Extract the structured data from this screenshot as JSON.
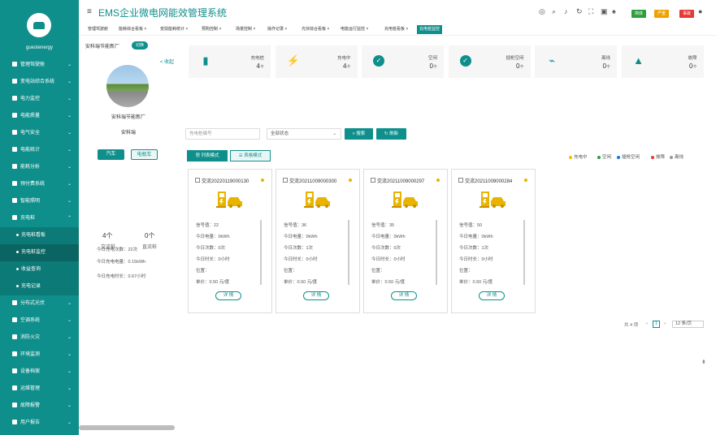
{
  "app": {
    "title": "EMS企业微电网能效管理系统",
    "user": "guestenergy"
  },
  "topbar": {
    "badges": [
      {
        "label": "简体",
        "color": "#2e9e3e"
      },
      {
        "label": "严重",
        "color": "#f0a000"
      },
      {
        "label": "事故",
        "color": "#e53935"
      }
    ]
  },
  "tabs": [
    "管理驾驶舱",
    "能耗综合看板",
    "变损能耗统计",
    "预购控制",
    "场景控制",
    "操作记录",
    "光伏综合看板",
    "电能运行监控",
    "充电桩看板",
    "充电桩监控"
  ],
  "sidebar": {
    "items": [
      {
        "label": "管理驾驶舱",
        "icon": "monitor-icon"
      },
      {
        "label": "变电站综合系统",
        "icon": "home-icon"
      },
      {
        "label": "电力监控",
        "icon": "gauge-icon"
      },
      {
        "label": "电能质量",
        "icon": "folder-icon"
      },
      {
        "label": "电气安全",
        "icon": "shield-icon"
      },
      {
        "label": "电能统计",
        "icon": "bar-chart-icon"
      },
      {
        "label": "能耗分析",
        "icon": "analysis-icon"
      },
      {
        "label": "预付费系统",
        "icon": "card-icon"
      },
      {
        "label": "智能照明",
        "icon": "bulb-icon"
      },
      {
        "label": "充电桩",
        "icon": "charger-icon"
      }
    ],
    "sub_items": [
      "充电桩看板",
      "充电桩监控",
      "收益查询",
      "充电记录"
    ],
    "items2": [
      {
        "label": "分布式光伏",
        "icon": "solar-icon"
      },
      {
        "label": "空调系统",
        "icon": "ac-icon"
      },
      {
        "label": "消防火灾",
        "icon": "fire-icon"
      },
      {
        "label": "环境监测",
        "icon": "env-icon"
      },
      {
        "label": "设备档案",
        "icon": "device-icon"
      },
      {
        "label": "运维管理",
        "icon": "maint-icon"
      },
      {
        "label": "故障报警",
        "icon": "alarm-icon"
      },
      {
        "label": "用户报告",
        "icon": "report-icon"
      }
    ]
  },
  "left": {
    "header": "安科瑞节能新厂",
    "switch": "切换",
    "collapse": "< 收起",
    "name": "安科瑞节能新厂",
    "status": "安科瑞",
    "mode_car": "汽车",
    "mode_ebike": "电瓶车",
    "stat_ac_val": "4个",
    "stat_ac_label": "交流桩",
    "stat_dc_val": "0个",
    "stat_dc_label": "直流桩",
    "today": [
      "今日充电次数：22次",
      "今日充电电量：0.15kWh",
      "今日充电时长：0.67小时"
    ]
  },
  "cards": [
    {
      "label": "充电桩",
      "value": "4",
      "unit": "个",
      "icon": "charger-icon"
    },
    {
      "label": "充电中",
      "value": "4",
      "unit": "个",
      "icon": "bolt-icon"
    },
    {
      "label": "空闲",
      "value": "0",
      "unit": "个",
      "icon": "check-icon"
    },
    {
      "label": "插枪空闲",
      "value": "0",
      "unit": "个",
      "icon": "check-icon"
    },
    {
      "label": "离线",
      "value": "0",
      "unit": "个",
      "icon": "plug-icon"
    },
    {
      "label": "故障",
      "value": "0",
      "unit": "个",
      "icon": "warning-icon"
    }
  ],
  "filters": {
    "code_placeholder": "充电桩编号",
    "status_value": "全部状态",
    "search": "搜索",
    "reset": "刷新"
  },
  "view": {
    "list": "列表模式",
    "table": "表格模式"
  },
  "legend": [
    {
      "label": "充电中",
      "color": "#f0c000"
    },
    {
      "label": "空闲",
      "color": "#2e9e3e"
    },
    {
      "label": "插枪空闲",
      "color": "#1976d2"
    },
    {
      "label": "故障",
      "color": "#e53935"
    },
    {
      "label": "离线",
      "color": "#999999"
    }
  ],
  "piles": [
    {
      "id": "交流20220119000130",
      "signal": "信号值：22",
      "energy": "今日电量：0kWh",
      "count": "今日次数：0次",
      "time": "今日时长：0小时",
      "pos": "位置：",
      "price": "单价：0.50 元/度",
      "detail": "详 情"
    },
    {
      "id": "交流20211009000300",
      "signal": "信号值：36",
      "energy": "今日电量：0kWh",
      "count": "今日次数：1次",
      "time": "今日时长：0小时",
      "pos": "位置：",
      "price": "单价：0.50 元/度",
      "detail": "详 情"
    },
    {
      "id": "交流20211009000297",
      "signal": "信号值：35",
      "energy": "今日电量：0kWh",
      "count": "今日次数：0次",
      "time": "今日时长：0小时",
      "pos": "位置：",
      "price": "单价：0.50 元/度",
      "detail": "详 情"
    },
    {
      "id": "交流20211009000284",
      "signal": "信号值：50",
      "energy": "今日电量：0kWh",
      "count": "今日次数：1次",
      "time": "今日时长：0小时",
      "pos": "位置：",
      "price": "单价：0.50 元/度",
      "detail": "详 情"
    }
  ],
  "pagination": {
    "total": "共 4 项",
    "page": "1",
    "size": "12 条/页"
  }
}
